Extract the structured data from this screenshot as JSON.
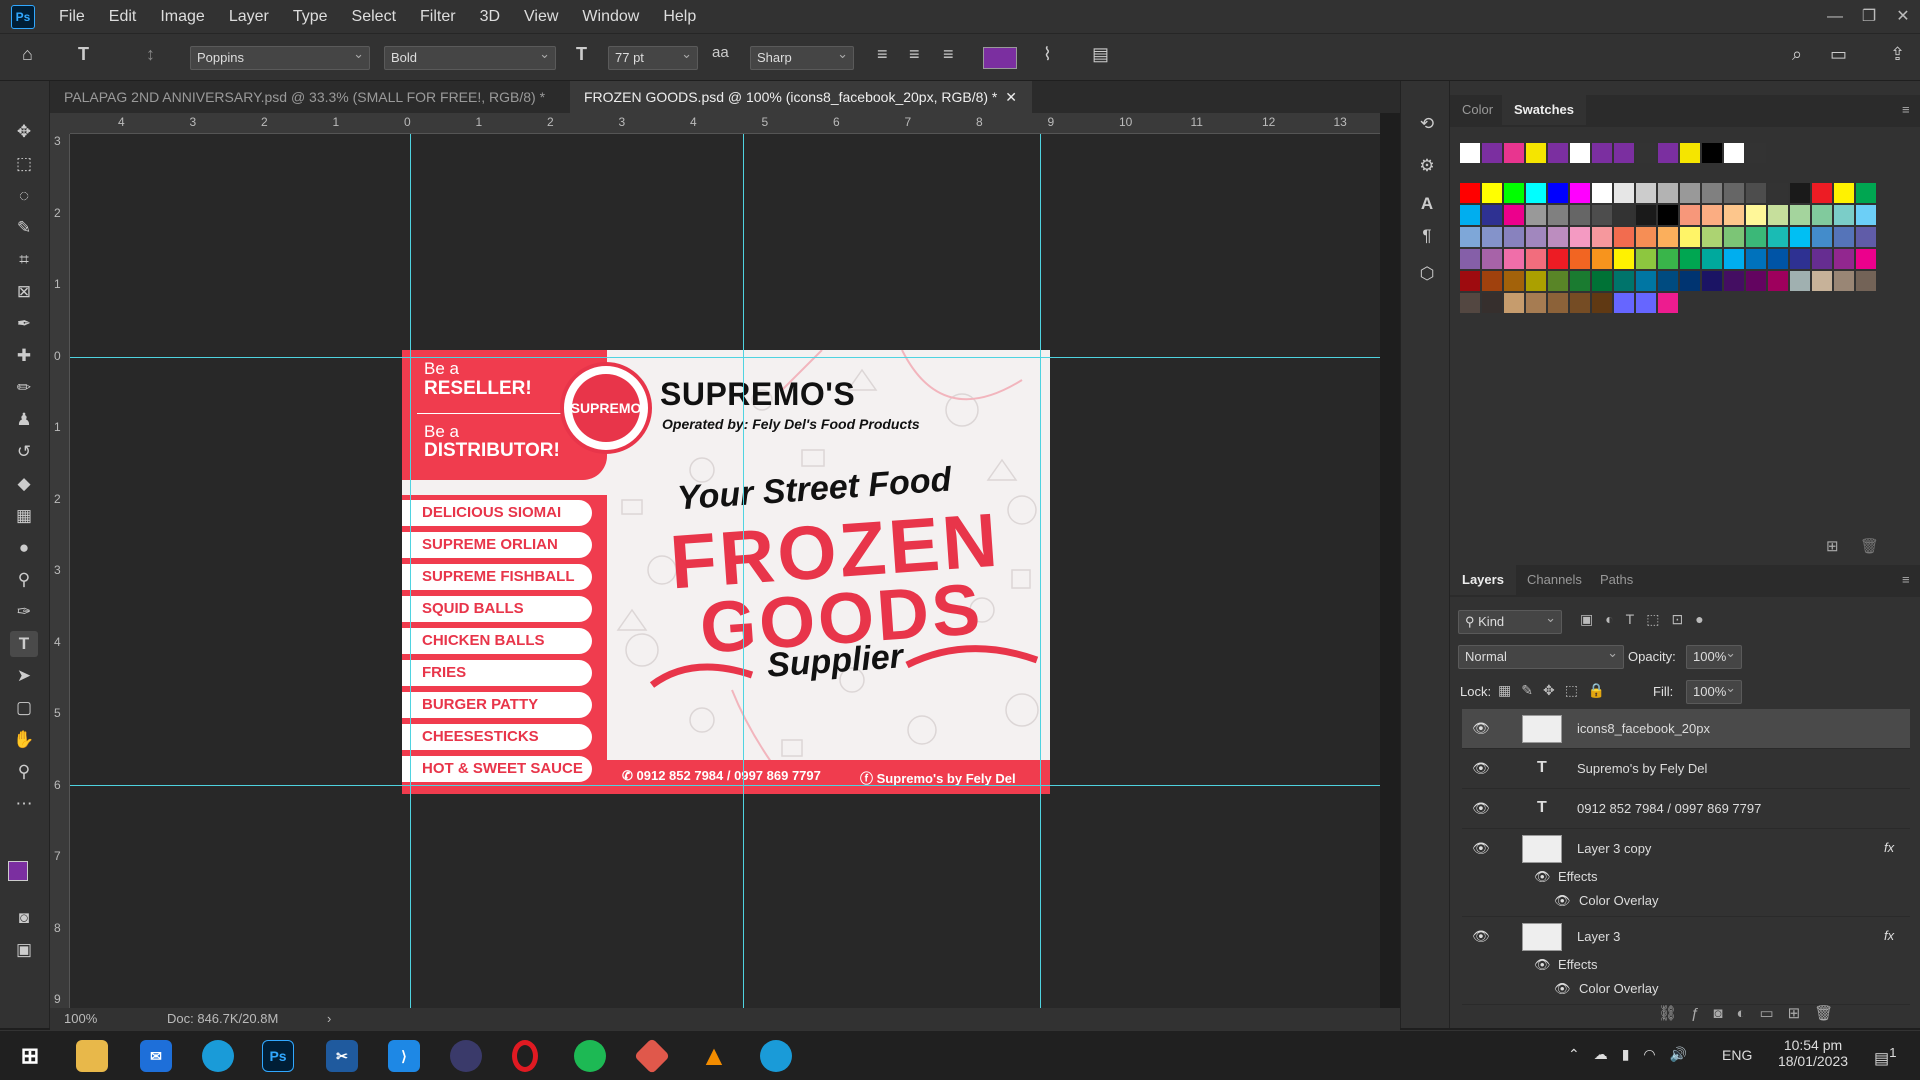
{
  "app": {
    "logo": "Ps"
  },
  "menu": [
    "File",
    "Edit",
    "Image",
    "Layer",
    "Type",
    "Select",
    "Filter",
    "3D",
    "View",
    "Window",
    "Help"
  ],
  "options": {
    "font_family": "Poppins",
    "font_style": "Bold",
    "font_size": "77 pt",
    "antialias_label": "aa",
    "antialias": "Sharp",
    "text_color": "#7b2fa0"
  },
  "tabs": [
    {
      "label": "PALAPAG 2ND ANNIVERSARY.psd @ 33.3% (SMALL FOR FREE!, RGB/8) *"
    },
    {
      "label": "FROZEN GOODS.psd @ 100% (icons8_facebook_20px, RGB/8) *"
    }
  ],
  "ruler_top": [
    "4",
    "3",
    "2",
    "1",
    "0",
    "1",
    "2",
    "3",
    "4",
    "5",
    "6",
    "7",
    "8",
    "9",
    "10",
    "11",
    "12",
    "13"
  ],
  "ruler_left": [
    "3",
    "2",
    "1",
    "0",
    "1",
    "2",
    "3",
    "4",
    "5",
    "6",
    "7",
    "8",
    "9"
  ],
  "status": {
    "zoom": "100%",
    "doc": "Doc: 846.7K/20.8M"
  },
  "design": {
    "reseller_pre": "Be a",
    "reseller": "RESELLER!",
    "distributor_pre": "Be a",
    "distributor": "DISTRIBUTOR!",
    "brand": "SUPREMO'S",
    "operated": "Operated by: Fely Del's Food Products",
    "logo_text": "SUPREMO",
    "tagline": "Your Street Food",
    "frozen": "FROZEN",
    "goods": "GOODS",
    "supplier": "Supplier",
    "menu_items": [
      "DELICIOUS SIOMAI",
      "SUPREME ORLIAN",
      "SUPREME FISHBALL",
      "SQUID BALLS",
      "CHICKEN BALLS",
      "FRIES",
      "BURGER PATTY",
      "CHEESESTICKS",
      "HOT & SWEET SAUCE"
    ],
    "phone": "0912 852 7984 / 0997 869 7797",
    "fb": "Supremo's by Fely Del"
  },
  "right_panel": {
    "color_tabs": [
      "Color",
      "Swatches"
    ],
    "layer_tabs": [
      "Layers",
      "Channels",
      "Paths"
    ],
    "filter_kind": "Kind",
    "blend_mode": "Normal",
    "opacity_label": "Opacity:",
    "opacity": "100%",
    "lock_label": "Lock:",
    "fill_label": "Fill:",
    "fill": "100%",
    "layers": [
      {
        "name": "icons8_facebook_20px",
        "type": "smart"
      },
      {
        "name": "Supremo's by Fely Del",
        "type": "text"
      },
      {
        "name": "0912 852 7984 / 0997 869 7797",
        "type": "text"
      },
      {
        "name": "Layer 3 copy",
        "type": "pixel",
        "effects": "Effects",
        "overlay": "Color Overlay"
      },
      {
        "name": "Layer 3",
        "type": "pixel",
        "effects": "Effects",
        "overlay": "Color Overlay"
      }
    ],
    "fx": "fx"
  },
  "taskbar": {
    "lang": "ENG",
    "time": "10:54 pm",
    "date": "18/01/2023",
    "notif": "1"
  },
  "colors": {
    "accent": "#f03c4e",
    "brand": "#e8354a"
  }
}
